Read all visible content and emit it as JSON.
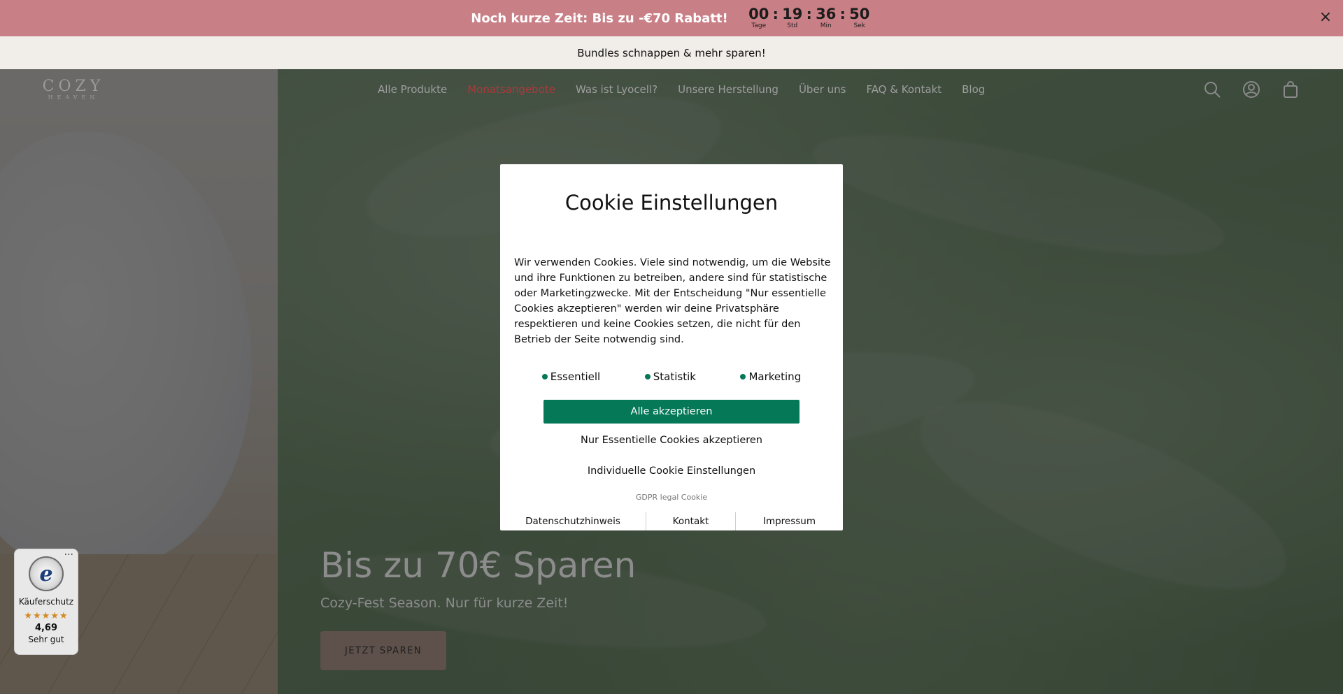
{
  "promo": {
    "text": "Noch kurze Zeit: Bis zu -€70 Rabatt!",
    "countdown": [
      {
        "value": "00",
        "label": "Tage"
      },
      {
        "value": "19",
        "label": "Std"
      },
      {
        "value": "36",
        "label": "Min"
      },
      {
        "value": "50",
        "label": "Sek"
      }
    ],
    "separator": ":",
    "close_icon": "×"
  },
  "subbar": {
    "text": "Bundles schnappen & mehr sparen!"
  },
  "header": {
    "logo_main": "COZY",
    "logo_sub": "HEAVEN",
    "nav": [
      "Alle Produkte",
      "Monatsangebote",
      "Was ist Lyocell?",
      "Unsere Herstellung",
      "Über uns",
      "FAQ & Kontakt",
      "Blog"
    ],
    "icons": [
      "search-icon",
      "account-icon",
      "cart-icon"
    ],
    "sale_color": "#a83b3b"
  },
  "hero": {
    "title": "Bis zu 70€ Sparen",
    "subtitle": "Cozy-Fest Season. Nur für kurze Zeit!",
    "cta": "JETZT SPAREN"
  },
  "trust_badge": {
    "label": "Käuferschutz",
    "stars": "★★★★★",
    "score": "4,69",
    "grade": "Sehr gut",
    "more": "···"
  },
  "cookie_modal": {
    "title": "Cookie Einstellungen",
    "text": "Wir verwenden Cookies. Viele sind notwendig, um die Website und ihre Funktionen zu betreiben, andere sind für statistische oder Marketingzwecke. Mit der Entscheidung \"Nur essentielle Cookies akzeptieren\" werden wir deine Privatsphäre respektieren und keine Cookies setzen, die nicht für den Betrieb der Seite notwendig sind.",
    "toggles": [
      "Essentiell",
      "Statistik",
      "Marketing"
    ],
    "accept_all": "Alle akzeptieren",
    "essential_only": "Nur Essentielle Cookies akzeptieren",
    "individual": "Individuelle Cookie Einstellungen",
    "gdpr": "GDPR legal Cookie",
    "links": [
      "Datenschutzhinweis",
      "Kontakt",
      "Impressum"
    ],
    "accent_color": "#047857"
  }
}
